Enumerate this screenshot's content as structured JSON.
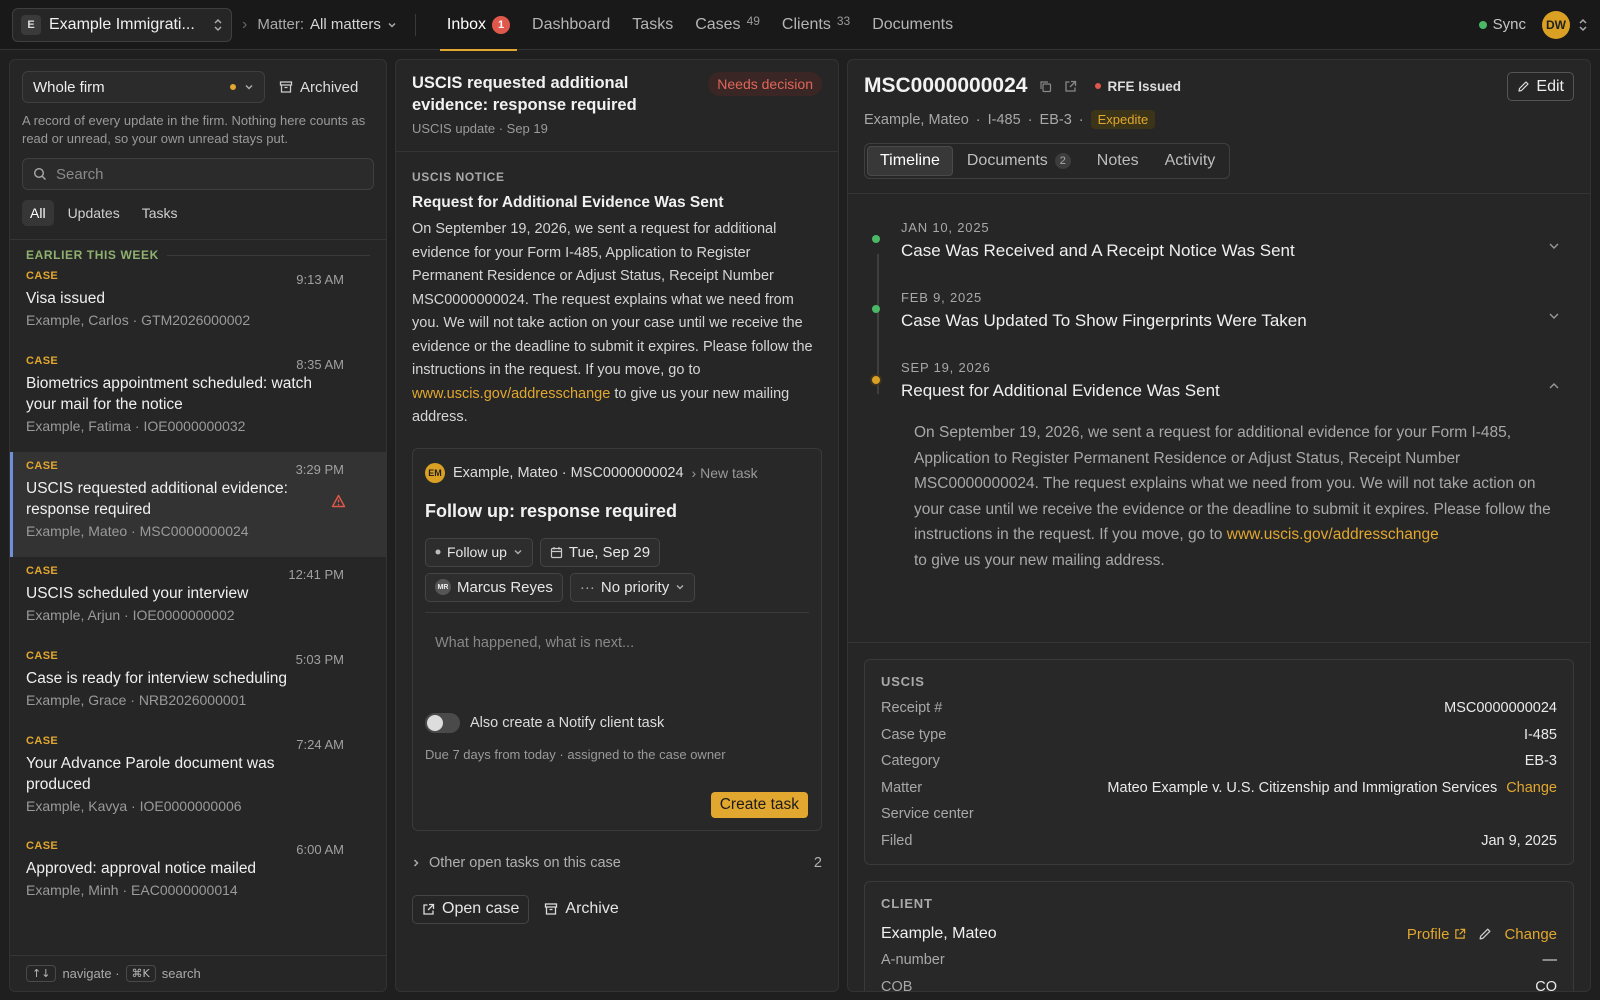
{
  "topbar": {
    "firm_initial": "E",
    "firm_name": "Example Immigrati...",
    "matter_label": "Matter:",
    "matter_value": "All matters",
    "nav": [
      {
        "label": "Inbox",
        "badge": "1"
      },
      {
        "label": "Dashboard"
      },
      {
        "label": "Tasks"
      },
      {
        "label": "Cases",
        "count": "49"
      },
      {
        "label": "Clients",
        "count": "33"
      },
      {
        "label": "Documents"
      }
    ],
    "sync_label": "Sync",
    "user_initials": "DW"
  },
  "left": {
    "scope": "Whole firm",
    "archived_label": "Archived",
    "description": "A record of every update in the firm. Nothing here counts as read or unread, so your own unread stays put.",
    "search_placeholder": "Search",
    "filters": [
      "All",
      "Updates",
      "Tasks"
    ],
    "group_label": "EARLIER THIS WEEK",
    "messages": [
      {
        "tag": "CASE",
        "time": "9:13 AM",
        "title": "Visa issued",
        "sub": "Example, Carlos · GTM2026000002"
      },
      {
        "tag": "CASE",
        "time": "8:35 AM",
        "title": "Biometrics appointment scheduled: watch your mail for the notice",
        "sub": "Example, Fatima · IOE0000000032"
      },
      {
        "tag": "CASE",
        "time": "3:29 PM",
        "title": "USCIS requested additional evidence: response required",
        "sub": "Example, Mateo · MSC0000000024"
      },
      {
        "tag": "CASE",
        "time": "12:41 PM",
        "title": "USCIS scheduled your interview",
        "sub": "Example, Arjun · IOE0000000002"
      },
      {
        "tag": "CASE",
        "time": "5:03 PM",
        "title": "Case is ready for interview scheduling",
        "sub": "Example, Grace · NRB2026000001"
      },
      {
        "tag": "CASE",
        "time": "7:24 AM",
        "title": "Your Advance Parole document was produced",
        "sub": "Example, Kavya · IOE0000000006"
      },
      {
        "tag": "CASE",
        "time": "6:00 AM",
        "title": "Approved: approval notice mailed",
        "sub": "Example, Minh · EAC0000000014"
      }
    ],
    "footer": {
      "nav_key": "↑↓",
      "nav_label": "navigate ·",
      "search_key": "⌘K",
      "search_label": "search"
    }
  },
  "middle": {
    "title": "USCIS requested additional evidence: response required",
    "subtitle": "USCIS update · Sep 19",
    "status": "Needs decision",
    "notice_label": "USCIS NOTICE",
    "notice_title": "Request for Additional Evidence Was Sent",
    "notice_body": "On September 19, 2026, we sent a request for additional evidence for your Form I-485, Application to Register Permanent Residence or Adjust Status, Receipt Number MSC0000000024. The request explains what we need from you. We will not take action on your case until we receive the evidence or the deadline to submit it expires. Please follow the instructions in the request. If you move, go to",
    "notice_link": "www.uscis.gov/addresschange",
    "notice_tail": "to give us your new mailing address.",
    "task": {
      "client_initials": "EM",
      "context": "Example, Mateo · MSC0000000024",
      "new_task": "New task",
      "title": "Follow up: response required",
      "type": "Follow up",
      "due": "Tue, Sep 29",
      "assignee_initials": "MR",
      "assignee": "Marcus Reyes",
      "priority": "No priority",
      "note_placeholder": "What happened, what is next...",
      "toggle_label": "Also create a Notify client task",
      "due_note": "Due 7 days from today · assigned to the case owner",
      "create_label": "Create task"
    },
    "other_tasks_label": "Other open tasks on this case",
    "other_tasks_count": "2",
    "open_case_label": "Open case",
    "archive_label": "Archive"
  },
  "right": {
    "receipt": "MSC0000000024",
    "status": "RFE Issued",
    "edit_label": "Edit",
    "client": "Example, Mateo",
    "form": "I-485",
    "category": "EB-3",
    "expedite": "Expedite",
    "tabs": [
      {
        "label": "Timeline"
      },
      {
        "label": "Documents",
        "count": "2"
      },
      {
        "label": "Notes"
      },
      {
        "label": "Activity"
      }
    ],
    "timeline": [
      {
        "date": "JAN 10, 2025",
        "title": "Case Was Received and A Receipt Notice Was Sent"
      },
      {
        "date": "FEB 9, 2025",
        "title": "Case Was Updated To Show Fingerprints Were Taken"
      },
      {
        "date": "SEP 19, 2026",
        "title": "Request for Additional Evidence Was Sent"
      }
    ],
    "timeline_body": "On September 19, 2026, we sent a request for additional evidence for your Form I-485, Application to Register Permanent Residence or Adjust Status, Receipt Number MSC0000000024. The request explains what we need from you. We will not take action on your case until we receive the evidence or the deadline to submit it expires. Please follow the instructions in the request. If you move, go to",
    "timeline_link": "www.uscis.gov/addresschange",
    "timeline_tail": "to give us your new mailing address.",
    "uscis": {
      "label": "USCIS",
      "rows": [
        {
          "k": "Receipt #",
          "v": "MSC0000000024"
        },
        {
          "k": "Case type",
          "v": "I-485"
        },
        {
          "k": "Category",
          "v": "EB-3"
        },
        {
          "k": "Matter",
          "v": "Mateo Example v. U.S. Citizenship and Immigration Services",
          "action": "Change"
        },
        {
          "k": "Service center",
          "v": ""
        },
        {
          "k": "Filed",
          "v": "Jan 9, 2025"
        }
      ]
    },
    "client_card": {
      "label": "CLIENT",
      "name": "Example, Mateo",
      "profile_label": "Profile",
      "change_label": "Change",
      "rows": [
        {
          "k": "A-number",
          "v": "—"
        },
        {
          "k": "COB",
          "v": "CO"
        }
      ]
    }
  },
  "colors": {
    "accent": "#e2a72e",
    "danger": "#e0584b",
    "success": "#4bb866",
    "selection": "#6f8fd8"
  }
}
